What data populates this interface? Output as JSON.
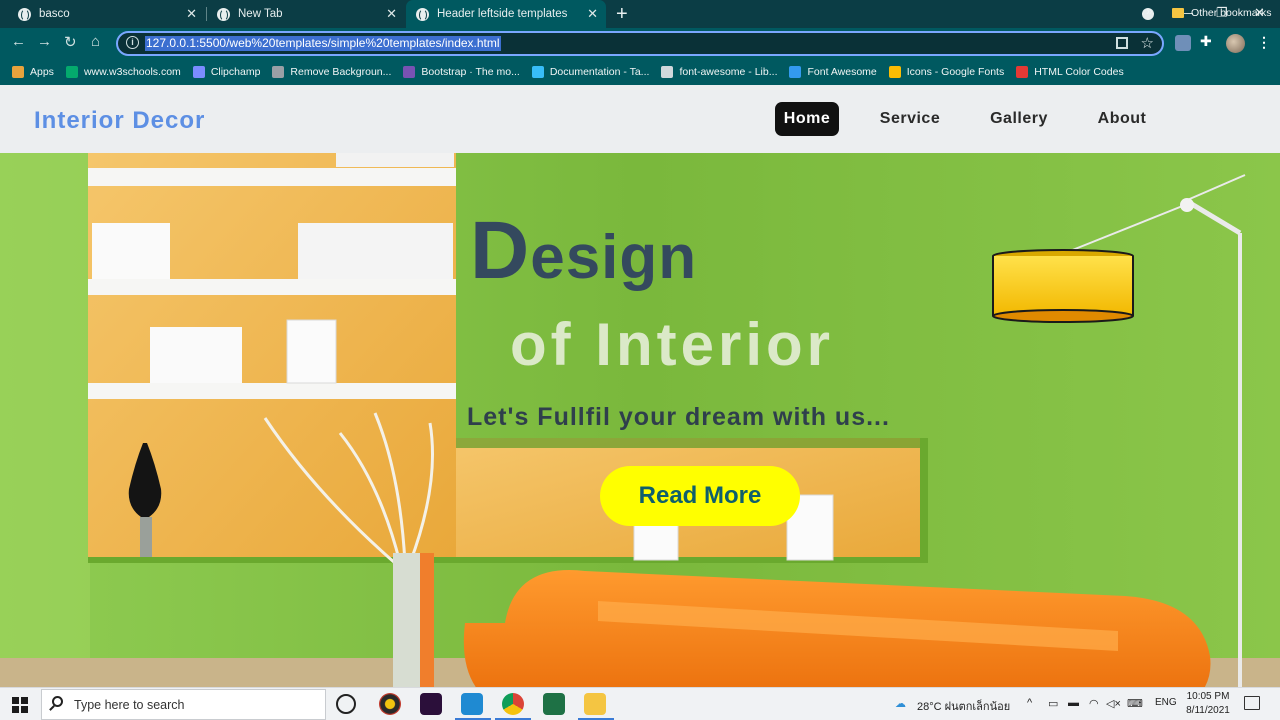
{
  "browser": {
    "tabs": [
      {
        "title": "basco"
      },
      {
        "title": "New Tab"
      },
      {
        "title": "Header leftside templates"
      }
    ],
    "url": "127.0.0.1:5500/web%20templates/simple%20templates/index.html",
    "bookmarks": [
      {
        "label": "Apps",
        "icon": "apps-grid-icon",
        "color": "#e8a33d"
      },
      {
        "label": "www.w3schools.com",
        "icon": "w3schools-icon",
        "color": "#04aa6d"
      },
      {
        "label": "Clipchamp",
        "icon": "clipchamp-icon",
        "color": "#7b8cff"
      },
      {
        "label": "Remove Backgroun...",
        "icon": "remove-bg-icon",
        "color": "#9aa0a6"
      },
      {
        "label": "Bootstrap · The mo...",
        "icon": "bootstrap-icon",
        "color": "#7952b3"
      },
      {
        "label": "Documentation - Ta...",
        "icon": "tailwind-icon",
        "color": "#38bdf8"
      },
      {
        "label": "font-awesome - Lib...",
        "icon": "code-brackets-icon",
        "color": "#cfd8dc"
      },
      {
        "label": "Font Awesome",
        "icon": "flag-icon",
        "color": "#339af0"
      },
      {
        "label": "Icons - Google Fonts",
        "icon": "google-fonts-icon",
        "color": "#fbbc04"
      },
      {
        "label": "HTML Color Codes",
        "icon": "color-codes-icon",
        "color": "#e53935"
      }
    ],
    "other_bookmarks": "Other bookmarks"
  },
  "site": {
    "logo": "Interior Decor",
    "nav": [
      "Home",
      "Service",
      "Gallery",
      "About"
    ],
    "hero": {
      "design_big": "D",
      "design_rest": "esign",
      "subtitle": "of Interior",
      "tagline": "Let's Fullfil your dream with us...",
      "cta": "Read More"
    },
    "colors": {
      "logo": "#5d8fe4",
      "cta_bg": "#ffff00",
      "cta_text": "#0f5f6c",
      "wall": "#7dbb3c"
    }
  },
  "taskbar": {
    "search_placeholder": "Type here to search",
    "weather": "28°C  ฝนตกเล็กน้อย",
    "lang": "ENG",
    "time": "10:05 PM",
    "date": "8/11/2021"
  }
}
